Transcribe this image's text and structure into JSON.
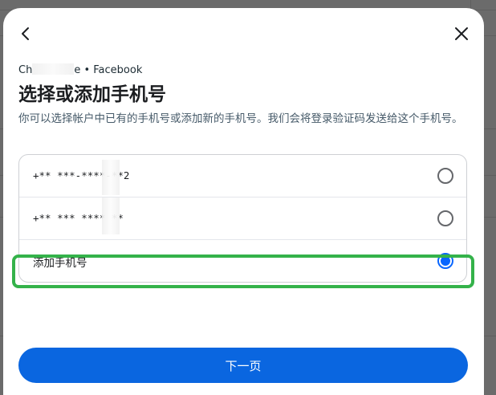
{
  "header": {
    "back_icon": "arrow-left-icon",
    "close_icon": "close-icon"
  },
  "subtitle": {
    "prefix": "Ch",
    "suffix": "e • Facebook"
  },
  "title": "选择或添加手机号",
  "description": "你可以选择帐户中已有的手机号或添加新的手机号。我们会将登录验证码发送给这个手机号。",
  "options": [
    {
      "label": "+** ***-****-**2",
      "selected": false
    },
    {
      "label": "+** *** **** **",
      "selected": false
    },
    {
      "label": "添加手机号",
      "selected": true
    }
  ],
  "next_button": "下一页",
  "colors": {
    "accent": "#0866ff",
    "button": "#0a66e0",
    "highlight": "#34b24a"
  }
}
